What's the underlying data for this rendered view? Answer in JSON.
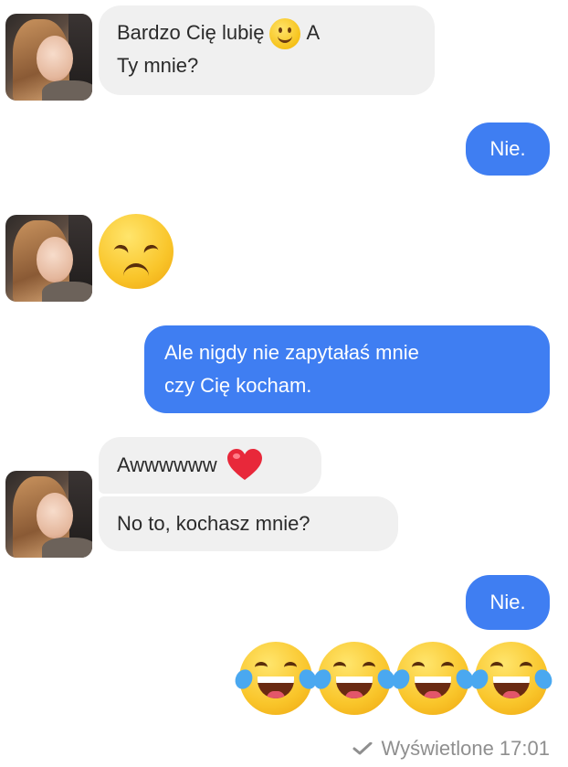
{
  "messages": [
    {
      "from": "them",
      "text_before": "Bardzo Cię lubię",
      "text_after": "A",
      "text_line2": "Ty mnie?",
      "emoji": "slightly-smiling-face"
    },
    {
      "from": "me",
      "text": "Nie."
    },
    {
      "from": "them",
      "emoji": "disappointed-face"
    },
    {
      "from": "me",
      "line1": "Ale nigdy nie zapytałaś mnie",
      "line2": "czy Cię kocham."
    },
    {
      "from": "them",
      "text": "Awwwwww",
      "emoji": "red-heart"
    },
    {
      "from": "them",
      "text": "No to, kochasz mnie?"
    },
    {
      "from": "me",
      "text": "Nie."
    },
    {
      "from": "me",
      "emoji": "face-with-tears-of-joy",
      "count": 4
    }
  ],
  "status": {
    "text": "Wyświetlone 17:01",
    "icon": "checkmark-icon"
  },
  "colors": {
    "outgoing": "#3f7ef2",
    "incoming": "#f0f0f0",
    "status": "#8f8f8f"
  }
}
